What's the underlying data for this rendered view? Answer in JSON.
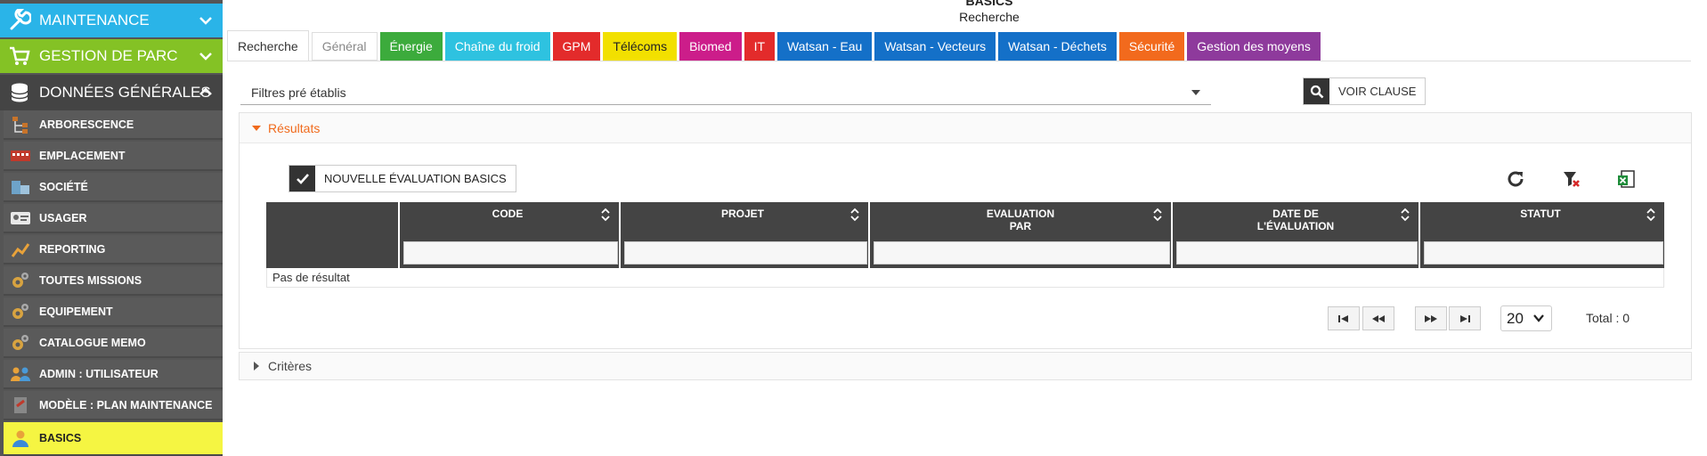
{
  "header": {
    "title": "BASICS",
    "subtitle": "Recherche"
  },
  "sidebar": {
    "sections": [
      {
        "label": "MAINTENANCE",
        "color": "#2ab4e8",
        "icon": "wrench-icon"
      },
      {
        "label": "GESTION DE PARC",
        "color": "#84c225",
        "icon": "cart-icon"
      },
      {
        "label": "DONNÉES GÉNÉRALES",
        "color": "#444444",
        "icon": "database-icon"
      }
    ],
    "items": [
      {
        "label": "ARBORESCENCE",
        "icon": "tree-icon"
      },
      {
        "label": "EMPLACEMENT",
        "icon": "building-icon"
      },
      {
        "label": "SOCIÉTÉ",
        "icon": "company-icon"
      },
      {
        "label": "USAGER",
        "icon": "id-card-icon"
      },
      {
        "label": "REPORTING",
        "icon": "chart-icon"
      },
      {
        "label": "TOUTES MISSIONS",
        "icon": "gears-icon"
      },
      {
        "label": "EQUIPEMENT",
        "icon": "gears-icon"
      },
      {
        "label": "CATALOGUE MEMO",
        "icon": "gears-icon"
      },
      {
        "label": "ADMIN : UTILISATEUR",
        "icon": "users-icon"
      },
      {
        "label": "MODÈLE : PLAN MAINTENANCE",
        "icon": "template-icon"
      },
      {
        "label": "BASICS",
        "icon": "user-icon",
        "active": true
      }
    ]
  },
  "tabs": [
    {
      "label": "Recherche",
      "color": "#ffffff",
      "style": "first"
    },
    {
      "label": "Général",
      "color": "#ffffff",
      "style": "gen"
    },
    {
      "label": "Énergie",
      "color": "#3cab3c"
    },
    {
      "label": "Chaîne du froid",
      "color": "#2ec2e0"
    },
    {
      "label": "GPM",
      "color": "#e32b2b"
    },
    {
      "label": "Télécoms",
      "color": "#f2e000",
      "dark": true
    },
    {
      "label": "Biomed",
      "color": "#cc1d8a"
    },
    {
      "label": "IT",
      "color": "#e32b2b"
    },
    {
      "label": "Watsan - Eau",
      "color": "#1470c8"
    },
    {
      "label": "Watsan - Vecteurs",
      "color": "#1470c8"
    },
    {
      "label": "Watsan - Déchets",
      "color": "#1470c8"
    },
    {
      "label": "Sécurité",
      "color": "#f26a1d"
    },
    {
      "label": "Gestion des moyens",
      "color": "#8e3a9c"
    }
  ],
  "filters": {
    "preset_label": "Filtres pré établis",
    "view_clause_label": "VOIR CLAUSE"
  },
  "results": {
    "title": "Résultats",
    "new_button_label": "NOUVELLE ÉVALUATION BASICS",
    "columns": [
      "CODE",
      "PROJET",
      "EVALUATION PAR",
      "DATE DE L'ÉVALUATION",
      "STATUT"
    ],
    "empty_text": "Pas de résultat",
    "page_size": "20",
    "total_label": "Total : 0"
  },
  "criteria": {
    "title": "Critères"
  }
}
